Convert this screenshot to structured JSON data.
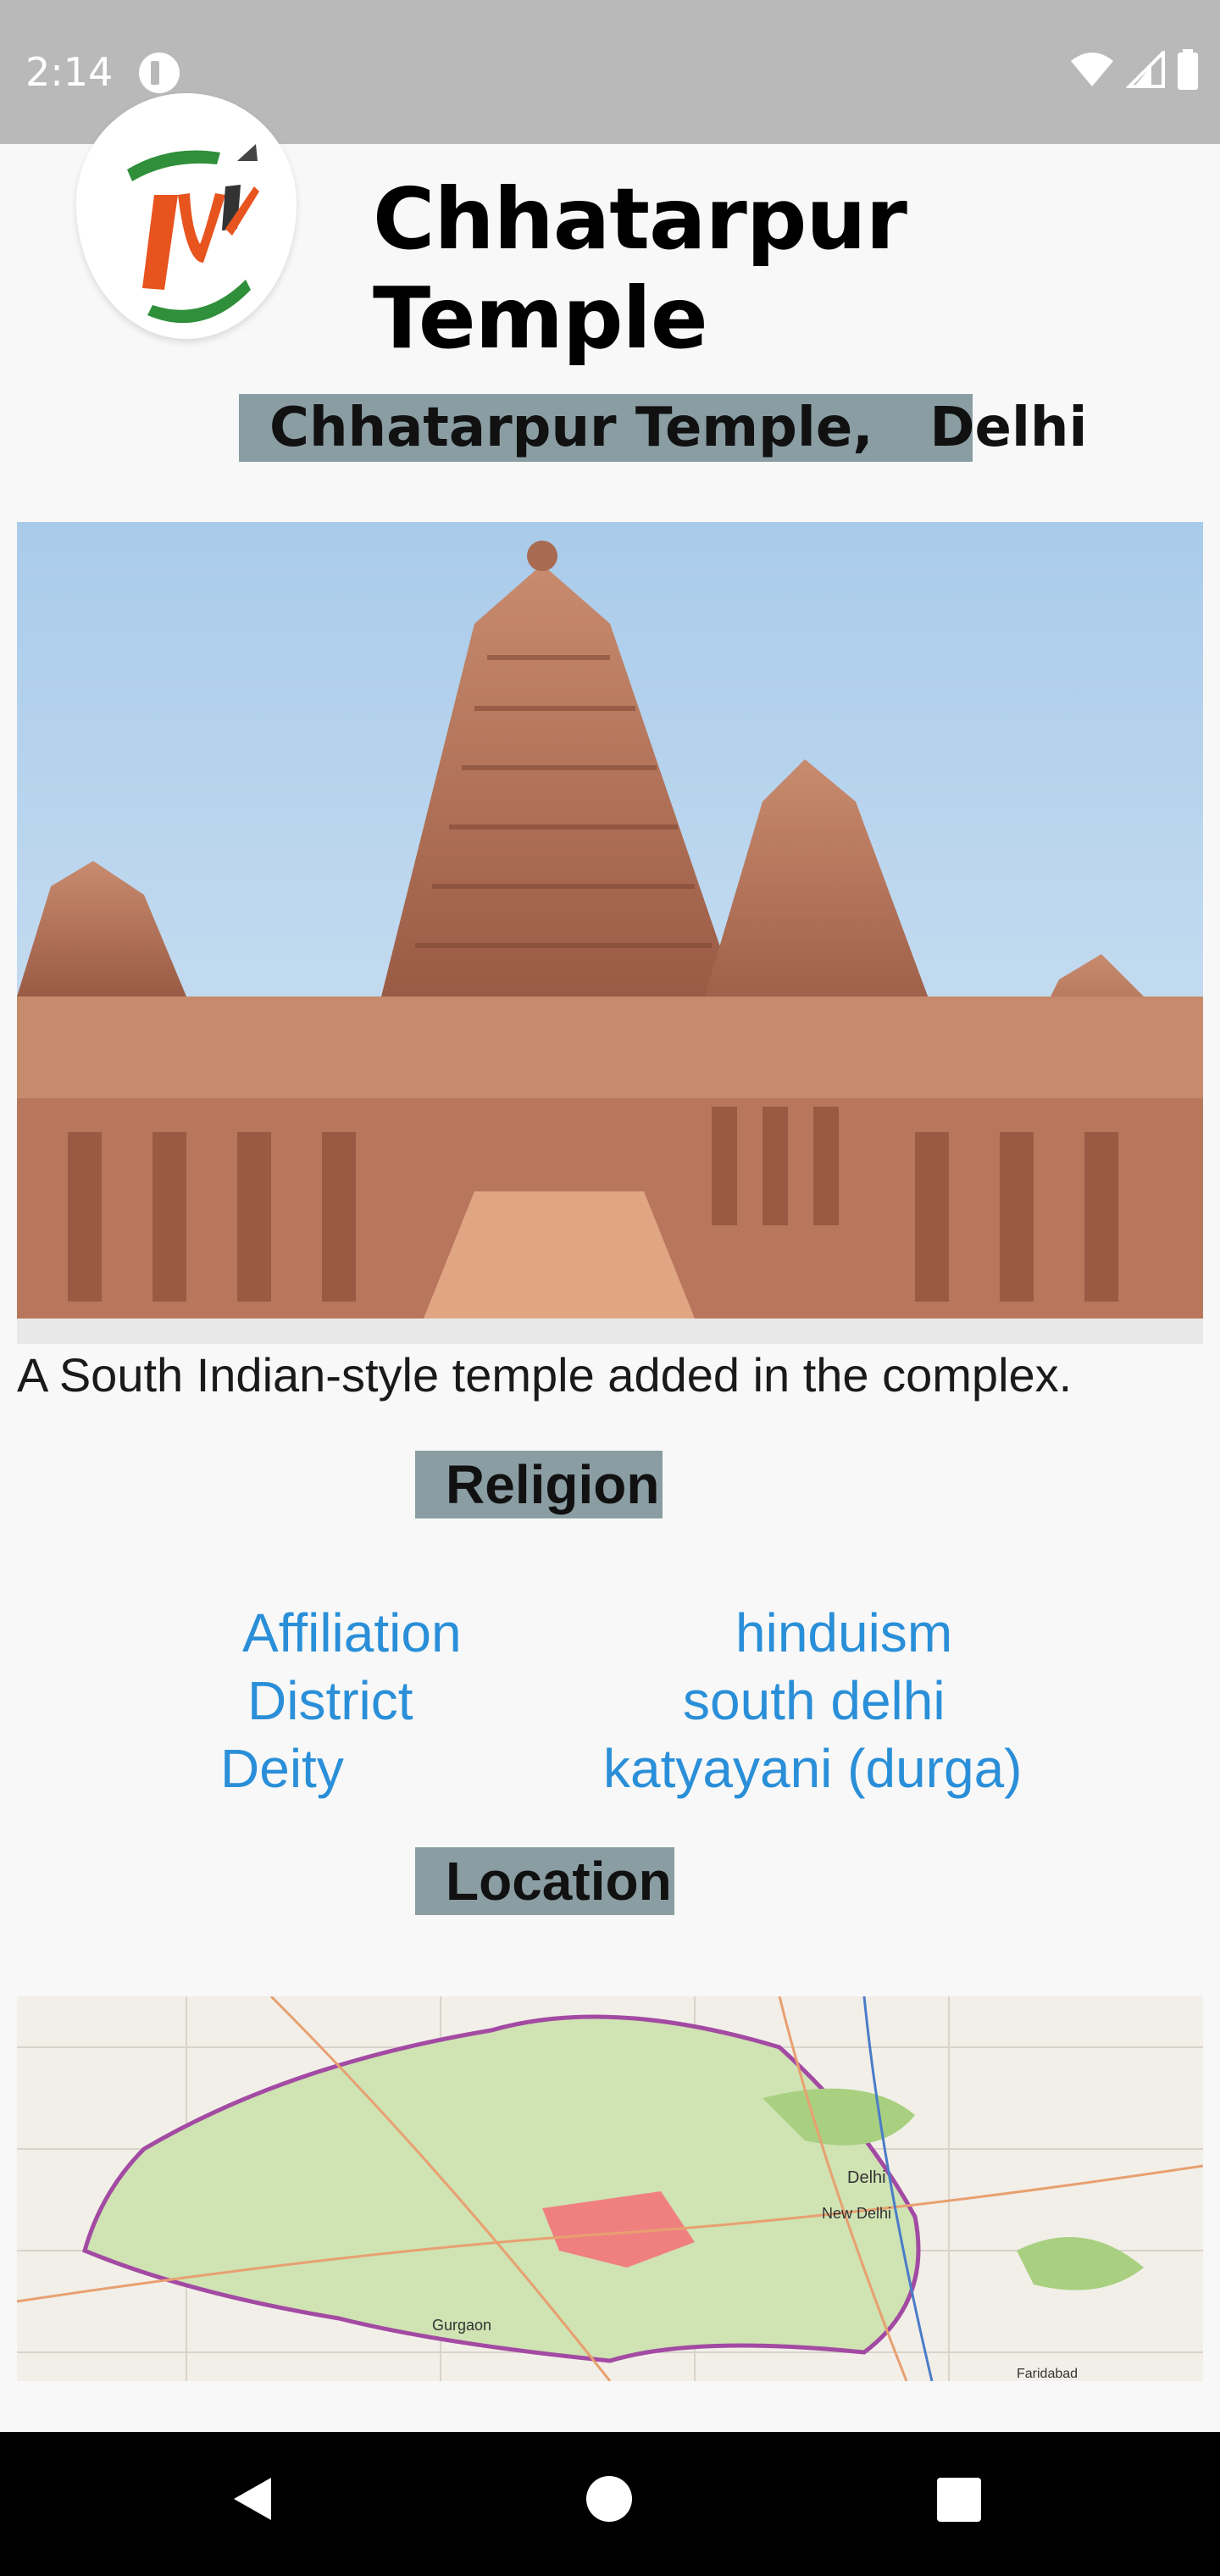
{
  "status_bar": {
    "time": "2:14",
    "icons": [
      "app-notification-icon",
      "wifi-icon",
      "cell-signal-icon",
      "battery-icon"
    ]
  },
  "header": {
    "app_title": "Chhatarpur Temple",
    "logo_icon": "ti-logo"
  },
  "place_badge": "Chhatarpur Temple,   Delhi",
  "photo": {
    "caption": "A South Indian-style temple added in the complex."
  },
  "religion_section": {
    "title": "Religion",
    "rows": [
      {
        "label": "Affiliation",
        "value": "hinduism"
      },
      {
        "label": "District",
        "value": "south delhi"
      },
      {
        "label": "Deity",
        "value": "katyayani (durga)"
      }
    ]
  },
  "location_section": {
    "title": "Location",
    "map_labels": [
      "Delhi",
      "New Delhi",
      "Gurgaon",
      "Faridabad"
    ]
  },
  "nav_bar": {
    "icons": [
      "back-icon",
      "home-icon",
      "recents-icon"
    ]
  },
  "colors": {
    "accent_link": "#2a8fd8",
    "badge_bg": "#8a9da3",
    "status_bar": "#b9b9b9"
  }
}
